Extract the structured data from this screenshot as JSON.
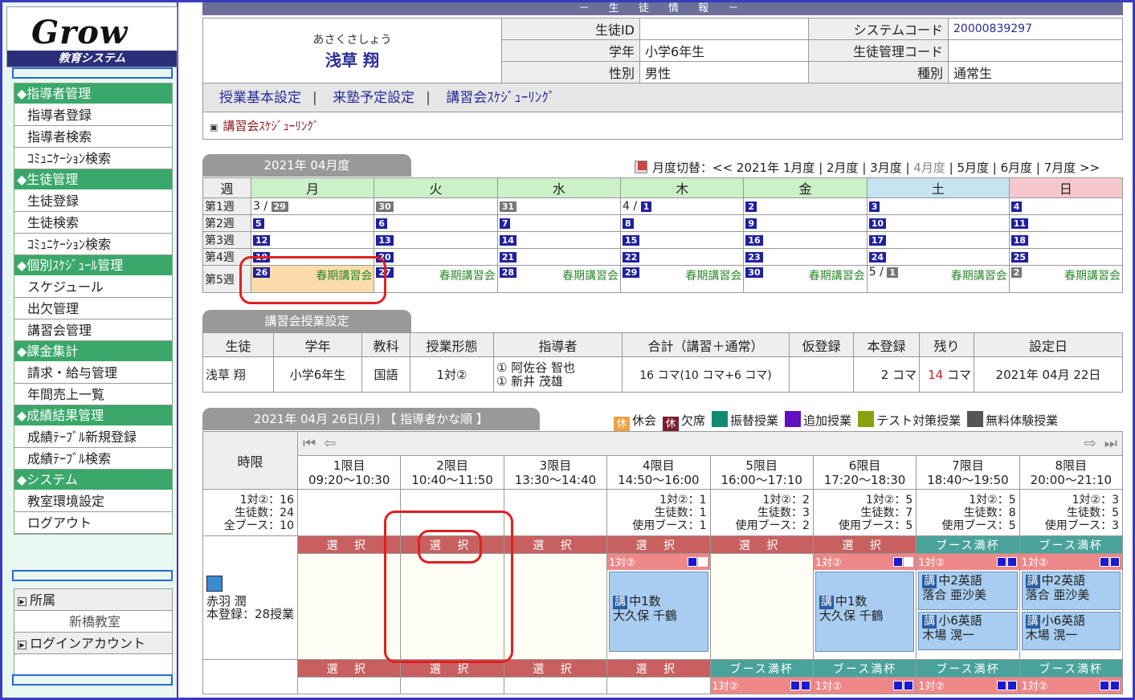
{
  "app": {
    "logo": "Grow",
    "logo_sub": "教育システム"
  },
  "sidebar": {
    "groups": [
      {
        "title": "指導者管理",
        "items": [
          "指導者登録",
          "指導者検索",
          "ｺﾐｭﾆｹｰｼｮﾝ検索"
        ]
      },
      {
        "title": "生徒管理",
        "items": [
          "生徒登録",
          "生徒検索",
          "ｺﾐｭﾆｹｰｼｮﾝ検索"
        ]
      },
      {
        "title": "個別ｽｹｼﾞｭｰﾙ管理",
        "items": [
          "スケジュール",
          "出欠管理",
          "講習会管理"
        ]
      },
      {
        "title": "課金集計",
        "items": [
          "請求・給与管理",
          "年間売上一覧"
        ]
      },
      {
        "title": "成績結果管理",
        "items": [
          "成績ﾃｰﾌﾞﾙ新規登録",
          "成績ﾃｰﾌﾞﾙ検索"
        ]
      },
      {
        "title": "システム",
        "items": [
          "教室環境設定",
          "ログアウト"
        ]
      }
    ],
    "affiliation_label": "所属",
    "affiliation_value": "新橋教室",
    "account_label": "ログインアカウント"
  },
  "student": {
    "banner": "－ 生 徒 情 報 －",
    "kana": "あさくさしょう",
    "name": "浅草 翔",
    "fields": [
      {
        "label": "生徒ID",
        "value": ""
      },
      {
        "label": "システムコード",
        "value": "20000839297"
      },
      {
        "label": "学年",
        "value": "小学6年生"
      },
      {
        "label": "生徒管理コード",
        "value": ""
      },
      {
        "label": "性別",
        "value": "男性"
      },
      {
        "label": "種別",
        "value": "通常生"
      }
    ]
  },
  "links": [
    "授業基本設定",
    "来塾予定設定",
    "講習会ｽｹｼﾞｭｰﾘﾝｸﾞ"
  ],
  "breadcrumb": "講習会ｽｹｼﾞｭｰﾘﾝｸﾞ",
  "calendar": {
    "tab": "2021年 04月度",
    "nav_label": "月度切替：<<",
    "months": [
      "2021年 1月度",
      "2月度",
      "3月度",
      "4月度",
      "5月度",
      "6月度",
      "7月度 >>"
    ],
    "current_month": "4月度",
    "week_header": "週",
    "days": [
      "月",
      "火",
      "水",
      "木",
      "金",
      "土",
      "日"
    ],
    "weeks": [
      {
        "label": "第1週",
        "cells": [
          "3 / 29",
          "30",
          "31",
          "4 / 1",
          "2",
          "3",
          "4"
        ]
      },
      {
        "label": "第2週",
        "cells": [
          "5",
          "6",
          "7",
          "8",
          "9",
          "10",
          "11"
        ]
      },
      {
        "label": "第3週",
        "cells": [
          "12",
          "13",
          "14",
          "15",
          "16",
          "17",
          "18"
        ]
      },
      {
        "label": "第4週",
        "cells": [
          "19",
          "20",
          "21",
          "22",
          "23",
          "24",
          "25"
        ]
      },
      {
        "label": "第5週",
        "cells": [
          "26",
          "27",
          "28",
          "29",
          "30",
          "5 / 1",
          "2"
        ]
      }
    ],
    "event": "春期講習会"
  },
  "setup": {
    "tab": "講習会授業設定",
    "headers": [
      "生徒",
      "学年",
      "教科",
      "授業形態",
      "指導者",
      "合計（講習＋通常）",
      "仮登録",
      "本登録",
      "残り",
      "設定日"
    ],
    "row": {
      "student": "浅草 翔",
      "grade": "小学6年生",
      "subject": "国語",
      "format": "1対②",
      "teacher1": "① 阿佐谷 智也",
      "teacher2": "① 新井 茂雄",
      "total": "16 コマ(10 コマ+6 コマ)",
      "temp": "",
      "registered": "2 コマ",
      "remaining": "14",
      "remaining_unit": "コマ",
      "date": "2021年 04月 22日"
    }
  },
  "schedule": {
    "tab": "2021年 04月 26日(月) 【 指導者かな順 】",
    "legend": [
      {
        "mark": "休",
        "label": "休会",
        "color": "#f0a040"
      },
      {
        "mark": "休",
        "label": "欠席",
        "color": "#7a2030"
      },
      {
        "mark": "",
        "label": "振替授業",
        "color": "#108a70"
      },
      {
        "mark": "",
        "label": "追加授業",
        "color": "#6010c0"
      },
      {
        "mark": "",
        "label": "テスト対策授業",
        "color": "#8aa010"
      },
      {
        "mark": "",
        "label": "無料体験授業",
        "color": "#555555"
      }
    ],
    "period_header": "時限",
    "periods": [
      {
        "name": "1限目",
        "time": "09:20～10:30"
      },
      {
        "name": "2限目",
        "time": "10:40～11:50"
      },
      {
        "name": "3限目",
        "time": "13:30～14:40"
      },
      {
        "name": "4限目",
        "time": "14:50～16:00"
      },
      {
        "name": "5限目",
        "time": "16:00～17:10"
      },
      {
        "name": "6限目",
        "time": "17:20～18:30"
      },
      {
        "name": "7限目",
        "time": "18:40～19:50"
      },
      {
        "name": "8限目",
        "time": "20:00～21:10"
      }
    ],
    "summary": [
      "1対②：16",
      "生徒数：24",
      "全ブース：10"
    ],
    "counts": [
      null,
      null,
      null,
      [
        "1対②：1",
        "生徒数：1",
        "使用ブース：1"
      ],
      [
        "1対②：2",
        "生徒数：3",
        "使用ブース：2"
      ],
      [
        "1対②：5",
        "生徒数：7",
        "使用ブース：5"
      ],
      [
        "1対②：5",
        "生徒数：8",
        "使用ブース：5"
      ],
      [
        "1対②：3",
        "生徒数：5",
        "使用ブース：3"
      ]
    ],
    "select": "選 択",
    "full": "ブース満杯",
    "format": "1対②",
    "teacher": {
      "name": "赤羽 潤",
      "reg": "本登録：28授業"
    },
    "cards": {
      "p4": [
        {
          "mark": "講",
          "subj": "中1数",
          "name": "大久保 千鶴"
        }
      ],
      "p6": [
        {
          "mark": "講",
          "subj": "中1数",
          "name": "大久保 千鶴"
        }
      ],
      "p7": [
        {
          "mark": "講",
          "subj": "中2英語",
          "name": "落合 亜沙美"
        },
        {
          "mark": "講",
          "subj": "小6英語",
          "name": "木場 滉一"
        }
      ],
      "p8": [
        {
          "mark": "講",
          "subj": "中2英語",
          "name": "落合 亜沙美"
        },
        {
          "mark": "講",
          "subj": "小6英語",
          "name": "木場 滉一"
        }
      ]
    }
  }
}
